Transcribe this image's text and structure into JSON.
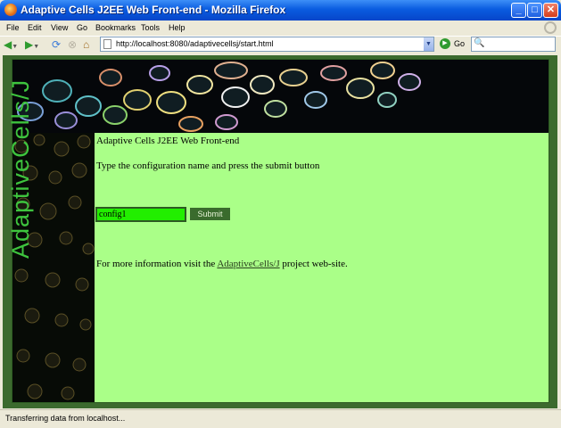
{
  "window": {
    "title": "Adaptive Cells J2EE Web Front-end - Mozilla Firefox",
    "controls": {
      "minimize": "_",
      "maximize": "□",
      "close": "✕"
    }
  },
  "menubar": {
    "items": [
      "File",
      "Edit",
      "View",
      "Go",
      "Bookmarks",
      "Tools",
      "Help"
    ]
  },
  "toolbar": {
    "url": "http://localhost:8080/adaptivecellsj/start.html",
    "go_label": "Go",
    "icons": [
      "back-icon",
      "forward-icon",
      "reload-icon",
      "stop-icon",
      "home-icon",
      "go-icon",
      "search-icon"
    ]
  },
  "page": {
    "side_banner_text": "AdaptiveCells/J",
    "heading": "Adaptive Cells J2EE Web Front-end",
    "instruction": "Type the configuration name and press the submit button",
    "input_value": "config1",
    "submit_label": "Submit",
    "info_prefix": "For more information visit the ",
    "info_link": "AdaptiveCells/J",
    "info_suffix": " project web-site.",
    "colors": {
      "page_background": "#aaff88",
      "input_background": "#22ee00",
      "button_background": "#3a6b2d",
      "frame": "#3c6a2e"
    }
  },
  "statusbar": {
    "text": "Transferring data from localhost..."
  }
}
